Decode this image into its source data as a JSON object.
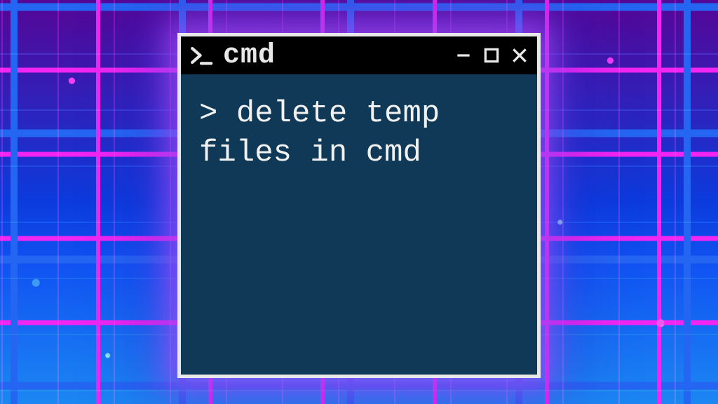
{
  "window": {
    "title": "cmd",
    "icon_name": "terminal-prompt-icon",
    "controls": {
      "minimize": "minimize",
      "maximize": "maximize",
      "close": "close"
    }
  },
  "terminal": {
    "prompt": "> ",
    "command": "delete temp files in cmd"
  }
}
